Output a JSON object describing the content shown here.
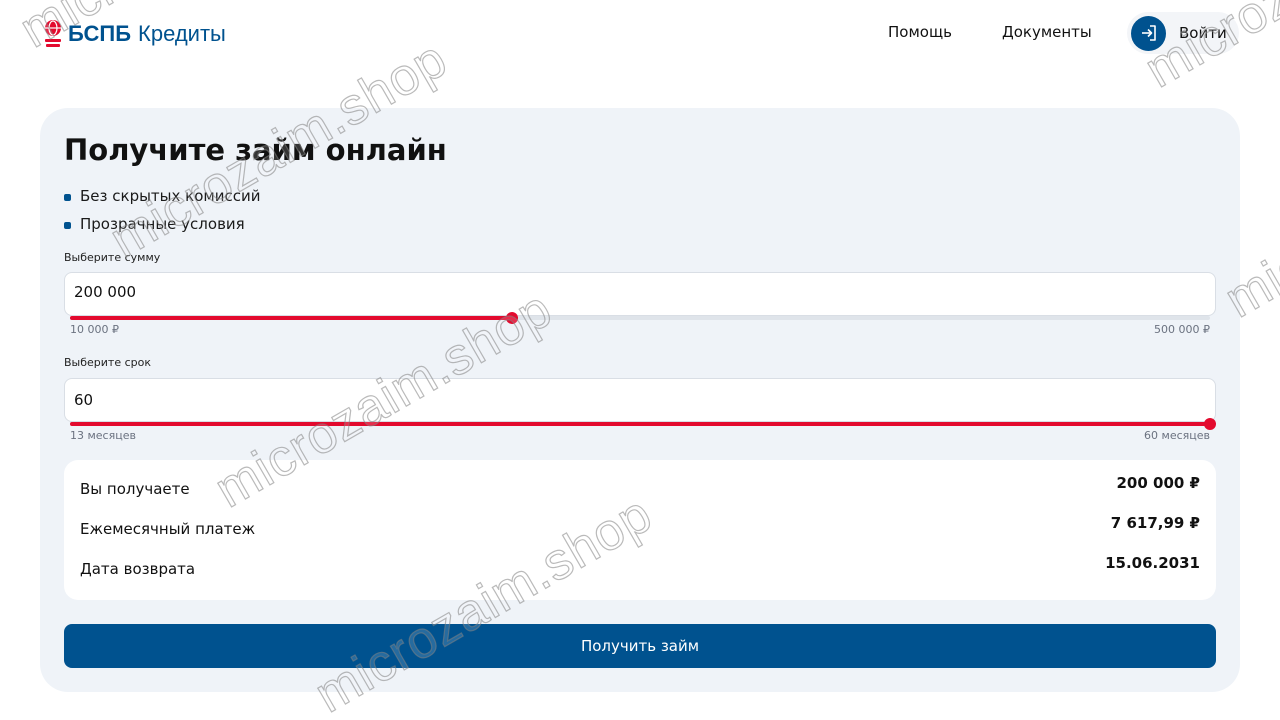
{
  "header": {
    "logo_brand": "БСПБ",
    "logo_product": "Кредиты",
    "nav_help": "Помощь",
    "nav_docs": "Документы",
    "login_label": "Войти"
  },
  "main": {
    "title": "Получите займ онлайн",
    "bullets": [
      "Без скрытых комиссий",
      "Прозрачные условия"
    ]
  },
  "amount": {
    "label": "Выберите сумму",
    "value": "200 000",
    "min_label": "10 000 ₽",
    "max_label": "500 000 ₽",
    "min": 10000,
    "max": 500000,
    "current": 200000
  },
  "term": {
    "label": "Выберите срок",
    "value": "60",
    "min_label": "13 месяцев",
    "max_label": "60 месяцев",
    "min": 13,
    "max": 60,
    "current": 60
  },
  "summary": [
    {
      "label": "Вы получаете",
      "value": "200 000 ₽"
    },
    {
      "label": "Ежемесячный платеж",
      "value": "7 617,99 ₽"
    },
    {
      "label": "Дата возврата",
      "value": "15.06.2031"
    }
  ],
  "cta_label": "Получить займ",
  "watermark": "microzaim.shop",
  "colors": {
    "brand_blue": "#00528f",
    "accent_red": "#e30a2e",
    "card_bg": "#eff3f8"
  },
  "icons": {
    "logo": "bspb-logo-icon",
    "login": "login-arrow-icon"
  }
}
